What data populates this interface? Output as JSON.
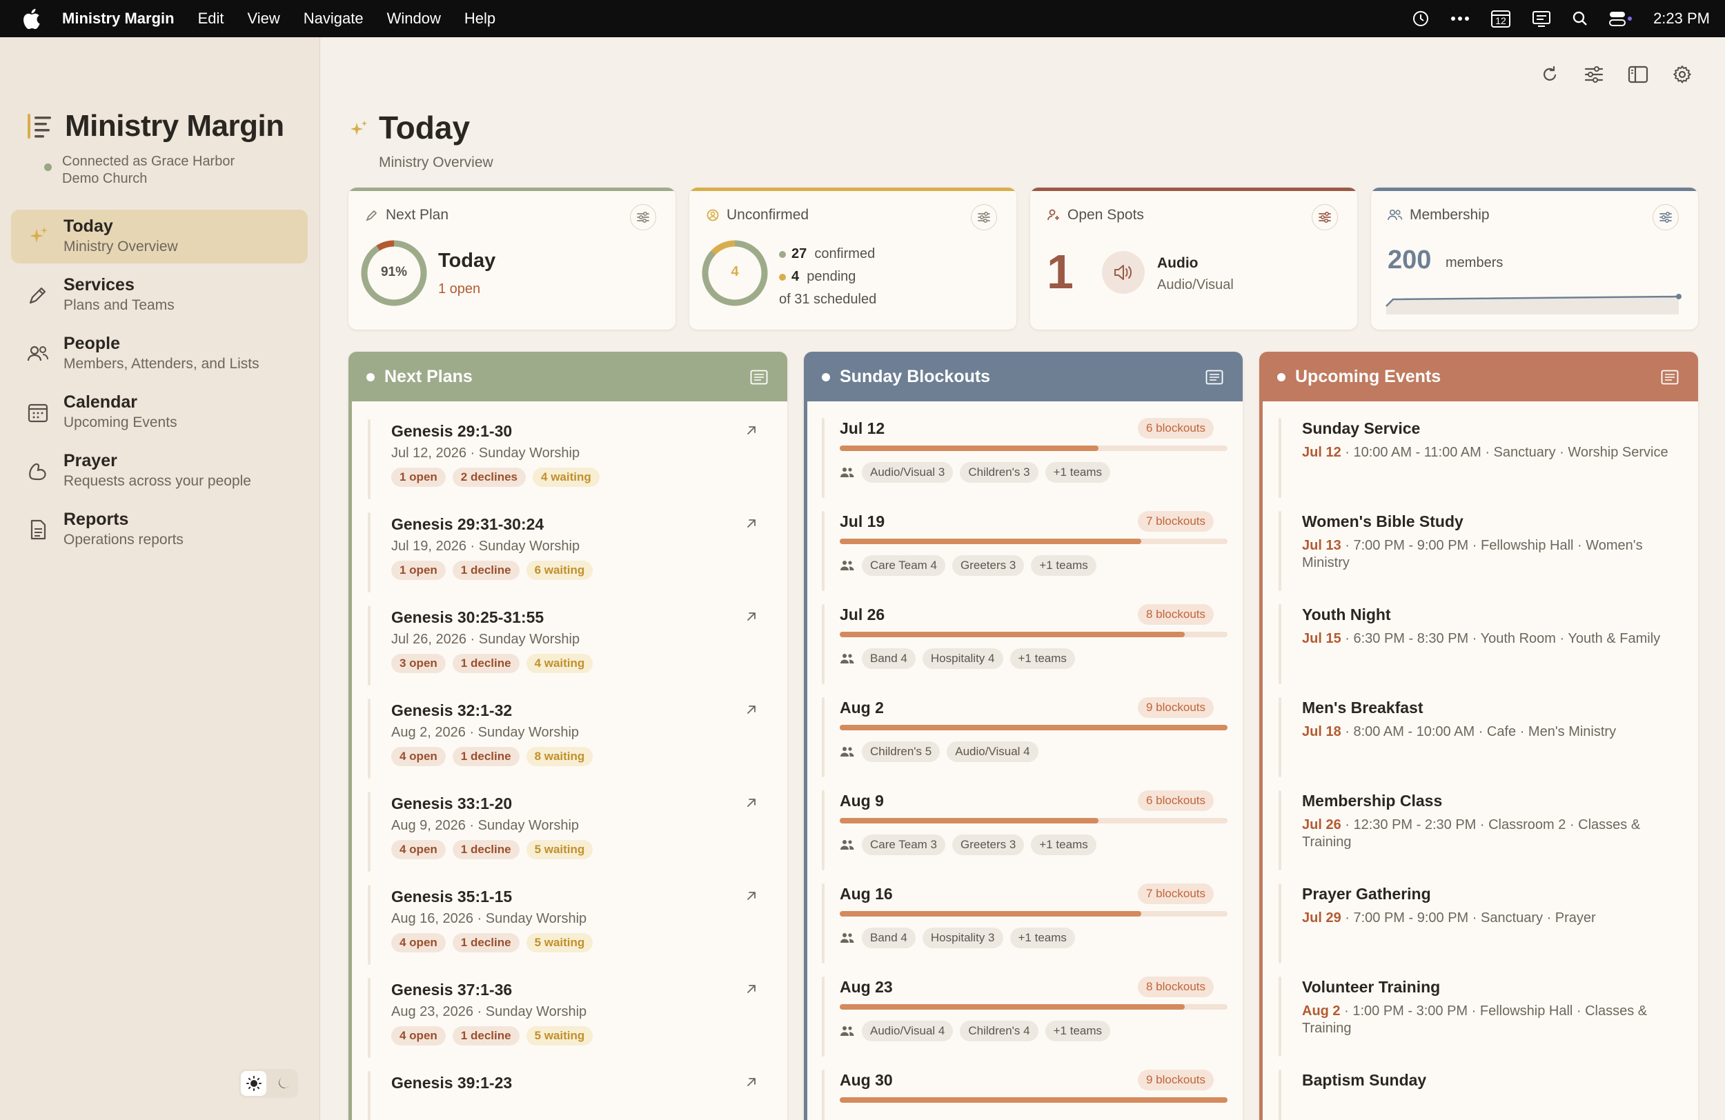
{
  "menubar": {
    "app": "Ministry Margin",
    "items": [
      "Edit",
      "View",
      "Navigate",
      "Window",
      "Help"
    ],
    "calendar_day": "12",
    "time": "2:23 PM"
  },
  "sidebar": {
    "brand": "Ministry Margin",
    "connection": "Connected as Grace Harbor Demo Church",
    "nav": [
      {
        "label": "Today",
        "sub": "Ministry Overview"
      },
      {
        "label": "Services",
        "sub": "Plans and Teams"
      },
      {
        "label": "People",
        "sub": "Members, Attenders, and Lists"
      },
      {
        "label": "Calendar",
        "sub": "Upcoming Events"
      },
      {
        "label": "Prayer",
        "sub": "Requests across your people"
      },
      {
        "label": "Reports",
        "sub": "Operations reports"
      }
    ]
  },
  "page": {
    "title": "Today",
    "subtitle": "Ministry Overview"
  },
  "cards": {
    "next_plan": {
      "title": "Next Plan",
      "percent": "91%",
      "percent_value": 0.91,
      "headline": "Today",
      "sub": "1 open"
    },
    "unconfirmed": {
      "title": "Unconfirmed",
      "count": "4",
      "confirmed_num": "27",
      "confirmed_label": "confirmed",
      "pending_num": "4",
      "pending_label": "pending",
      "scheduled": "of 31 scheduled",
      "confirmed_fraction": 0.87
    },
    "open_spots": {
      "title": "Open Spots",
      "count": "1",
      "team": "Audio",
      "sub": "Audio/Visual"
    },
    "membership": {
      "title": "Membership",
      "count": "200",
      "label": "members"
    }
  },
  "columns": {
    "plans": {
      "title": "Next Plans",
      "items": [
        {
          "title": "Genesis 29:1-30",
          "date": "Jul 12, 2026 · Sunday Worship",
          "open": "1 open",
          "decline": "2 declines",
          "waiting": "4 waiting"
        },
        {
          "title": "Genesis 29:31-30:24",
          "date": "Jul 19, 2026 · Sunday Worship",
          "open": "1 open",
          "decline": "1 decline",
          "waiting": "6 waiting"
        },
        {
          "title": "Genesis 30:25-31:55",
          "date": "Jul 26, 2026 · Sunday Worship",
          "open": "3 open",
          "decline": "1 decline",
          "waiting": "4 waiting"
        },
        {
          "title": "Genesis 32:1-32",
          "date": "Aug 2, 2026 · Sunday Worship",
          "open": "4 open",
          "decline": "1 decline",
          "waiting": "8 waiting"
        },
        {
          "title": "Genesis 33:1-20",
          "date": "Aug 9, 2026 · Sunday Worship",
          "open": "4 open",
          "decline": "1 decline",
          "waiting": "5 waiting"
        },
        {
          "title": "Genesis 35:1-15",
          "date": "Aug 16, 2026 · Sunday Worship",
          "open": "4 open",
          "decline": "1 decline",
          "waiting": "5 waiting"
        },
        {
          "title": "Genesis 37:1-36",
          "date": "Aug 23, 2026 · Sunday Worship",
          "open": "4 open",
          "decline": "1 decline",
          "waiting": "5 waiting"
        },
        {
          "title": "Genesis 39:1-23",
          "date": "",
          "open": "",
          "decline": "",
          "waiting": ""
        }
      ]
    },
    "blockouts": {
      "title": "Sunday Blockouts",
      "items": [
        {
          "date": "Jul 12",
          "badge": "6 blockouts",
          "fill": 0.667,
          "tags": [
            "Audio/Visual 3",
            "Children's 3",
            "+1 teams"
          ]
        },
        {
          "date": "Jul 19",
          "badge": "7 blockouts",
          "fill": 0.778,
          "tags": [
            "Care Team 4",
            "Greeters 3",
            "+1 teams"
          ]
        },
        {
          "date": "Jul 26",
          "badge": "8 blockouts",
          "fill": 0.889,
          "tags": [
            "Band 4",
            "Hospitality 4",
            "+1 teams"
          ]
        },
        {
          "date": "Aug 2",
          "badge": "9 blockouts",
          "fill": 1.0,
          "tags": [
            "Children's 5",
            "Audio/Visual 4"
          ]
        },
        {
          "date": "Aug 9",
          "badge": "6 blockouts",
          "fill": 0.667,
          "tags": [
            "Care Team 3",
            "Greeters 3",
            "+1 teams"
          ]
        },
        {
          "date": "Aug 16",
          "badge": "7 blockouts",
          "fill": 0.778,
          "tags": [
            "Band 4",
            "Hospitality 3",
            "+1 teams"
          ]
        },
        {
          "date": "Aug 23",
          "badge": "8 blockouts",
          "fill": 0.889,
          "tags": [
            "Audio/Visual 4",
            "Children's 4",
            "+1 teams"
          ]
        },
        {
          "date": "Aug 30",
          "badge": "9 blockouts",
          "fill": 1.0,
          "tags": []
        }
      ]
    },
    "events": {
      "title": "Upcoming Events",
      "items": [
        {
          "title": "Sunday Service",
          "date": "Jul 12",
          "detail": " · 10:00 AM - 11:00 AM · Sanctuary · Worship Service"
        },
        {
          "title": "Women's Bible Study",
          "date": "Jul 13",
          "detail": " · 7:00 PM - 9:00 PM · Fellowship Hall · Women's Ministry"
        },
        {
          "title": "Youth Night",
          "date": "Jul 15",
          "detail": " · 6:30 PM - 8:30 PM · Youth Room · Youth & Family"
        },
        {
          "title": "Men's Breakfast",
          "date": "Jul 18",
          "detail": " · 8:00 AM - 10:00 AM · Cafe · Men's Ministry"
        },
        {
          "title": "Membership Class",
          "date": "Jul 26",
          "detail": " · 12:30 PM - 2:30 PM · Classroom 2 · Classes & Training"
        },
        {
          "title": "Prayer Gathering",
          "date": "Jul 29",
          "detail": " · 7:00 PM - 9:00 PM · Sanctuary · Prayer"
        },
        {
          "title": "Volunteer Training",
          "date": "Aug 2",
          "detail": " · 1:00 PM - 3:00 PM · Fellowship Hall · Classes & Training"
        },
        {
          "title": "Baptism Sunday",
          "date": "",
          "detail": ""
        }
      ]
    }
  },
  "colors": {
    "sage": "#9eab8a",
    "slate": "#6e7f94",
    "terracotta": "#c07a5f",
    "gold": "#d8ad4c",
    "accent_text": "#b35a32"
  }
}
